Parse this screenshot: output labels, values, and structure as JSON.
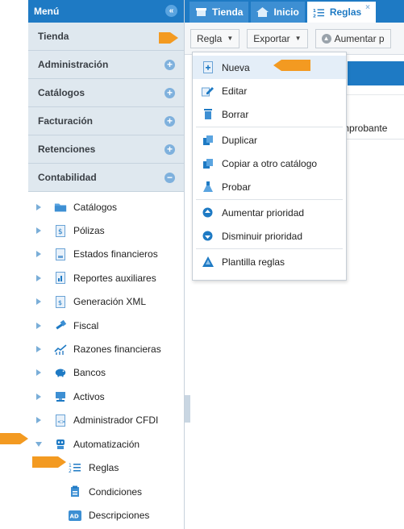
{
  "sidebar": {
    "title": "Menú",
    "sections": [
      {
        "label": "Tienda"
      },
      {
        "label": "Administración"
      },
      {
        "label": "Catálogos"
      },
      {
        "label": "Facturación"
      },
      {
        "label": "Retenciones"
      },
      {
        "label": "Contabilidad"
      }
    ],
    "tree": [
      {
        "label": "Catálogos",
        "icon": "folder-icon"
      },
      {
        "label": "Pólizas",
        "icon": "document-dollar-icon"
      },
      {
        "label": "Estados financieros",
        "icon": "report-icon"
      },
      {
        "label": "Reportes auxiliares",
        "icon": "bar-chart-doc-icon"
      },
      {
        "label": "Generación XML",
        "icon": "xml-doc-icon"
      },
      {
        "label": "Fiscal",
        "icon": "hammer-icon"
      },
      {
        "label": "Razones financieras",
        "icon": "trend-chart-icon"
      },
      {
        "label": "Bancos",
        "icon": "piggy-bank-icon"
      },
      {
        "label": "Activos",
        "icon": "computer-icon"
      },
      {
        "label": "Administrador CFDI",
        "icon": "code-doc-icon"
      },
      {
        "label": "Automatización",
        "icon": "robot-icon"
      }
    ],
    "subtree": [
      {
        "label": "Reglas",
        "icon": "ordered-list-icon"
      },
      {
        "label": "Condiciones",
        "icon": "clipboard-icon"
      },
      {
        "label": "Descripciones",
        "icon": "ad-badge-icon",
        "badge": "AD"
      }
    ]
  },
  "tabs": [
    {
      "label": "Tienda",
      "icon": "store-icon"
    },
    {
      "label": "Inicio",
      "icon": "home-icon"
    },
    {
      "label": "Reglas",
      "icon": "ordered-list-icon",
      "close": "×"
    }
  ],
  "toolbar": {
    "regla_label": "Regla",
    "exportar_label": "Exportar",
    "aumentar_label": "Aumentar p"
  },
  "grid": {
    "column_header": "mprobante"
  },
  "menu": {
    "items": [
      {
        "label": "Nueva",
        "icon": "new-doc-icon"
      },
      {
        "label": "Editar",
        "icon": "edit-icon"
      },
      {
        "label": "Borrar",
        "icon": "trash-icon"
      },
      {
        "label": "Duplicar",
        "icon": "duplicate-icon"
      },
      {
        "label": "Copiar a otro catálogo",
        "icon": "copy-icon"
      },
      {
        "label": "Probar",
        "icon": "flask-icon"
      },
      {
        "label": "Aumentar prioridad",
        "icon": "arrow-up-circle-icon"
      },
      {
        "label": "Disminuir prioridad",
        "icon": "arrow-down-circle-icon"
      },
      {
        "label": "Plantilla reglas",
        "icon": "template-icon"
      }
    ]
  },
  "colors": {
    "accent": "#1e7ac4",
    "annotation": "#f39a21",
    "section_bg": "#dfe8ef"
  }
}
